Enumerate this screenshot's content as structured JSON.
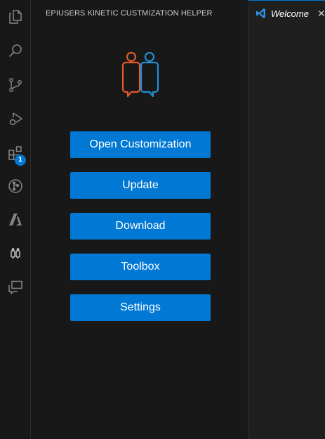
{
  "activity_bar": {
    "items": [
      {
        "name": "explorer-icon"
      },
      {
        "name": "search-icon"
      },
      {
        "name": "source-control-icon"
      },
      {
        "name": "run-debug-icon"
      },
      {
        "name": "extensions-icon",
        "badge": "1"
      },
      {
        "name": "git-graph-icon"
      },
      {
        "name": "azure-icon"
      },
      {
        "name": "epiusers-icon"
      },
      {
        "name": "remote-chat-icon"
      }
    ]
  },
  "side_panel": {
    "title": "EPIUSERS KINETIC CUSTMIZATION HELPER",
    "logo_icon": "epiusers-logo-icon",
    "buttons": [
      {
        "label": "Open Customization"
      },
      {
        "label": "Update"
      },
      {
        "label": "Download"
      },
      {
        "label": "Toolbox"
      },
      {
        "label": "Settings"
      }
    ]
  },
  "editor": {
    "tabs": [
      {
        "label": "Welcome",
        "icon": "vscode-icon",
        "close_glyph": "✕"
      }
    ]
  },
  "colors": {
    "accent": "#0078d4",
    "logo_orange": "#e05a2b",
    "logo_blue": "#1e8fd5"
  }
}
